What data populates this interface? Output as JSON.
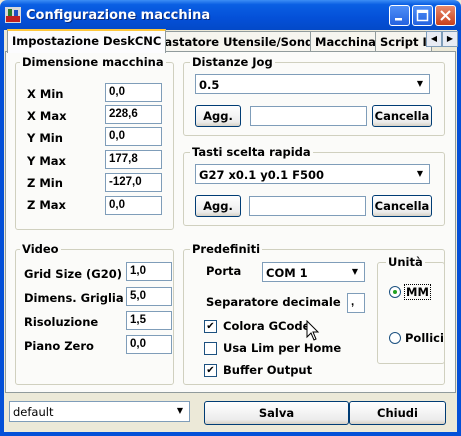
{
  "window": {
    "title": "Configurazione macchina"
  },
  "tabs": [
    "Impostazione DeskCNC",
    "Tastatore Utensile/Sonda",
    "Macchina",
    "Script I"
  ],
  "dimensione": {
    "title": "Dimensione macchina",
    "rows": [
      {
        "label": "X Min",
        "value": "0,0"
      },
      {
        "label": "X Max",
        "value": "228,6"
      },
      {
        "label": "Y Min",
        "value": "0,0"
      },
      {
        "label": "Y Max",
        "value": "177,8"
      },
      {
        "label": "Z Min",
        "value": "-127,0"
      },
      {
        "label": "Z Max",
        "value": "0,0"
      }
    ]
  },
  "jog": {
    "title": "Distanze Jog",
    "selected": "0.5",
    "add": "Agg.",
    "input": "",
    "delete": "Cancella"
  },
  "rapidi": {
    "title": "Tasti scelta rapida",
    "selected": "G27 x0.1 y0.1 F500",
    "add": "Agg.",
    "input": "",
    "delete": "Cancella"
  },
  "video": {
    "title": "Video",
    "rows": [
      {
        "label": "Grid Size (G20)",
        "value": "1,0"
      },
      {
        "label": "Dimens. Griglia",
        "value": "5,0"
      },
      {
        "label": "Risoluzione",
        "value": "1,5"
      },
      {
        "label": "Piano Zero",
        "value": "0,0"
      }
    ]
  },
  "predefiniti": {
    "title": "Predefiniti",
    "porta_label": "Porta",
    "porta_value": "COM 1",
    "separatore_label": "Separatore decimale",
    "separatore_value": ",",
    "colora": {
      "label": "Colora GCode",
      "checked": true
    },
    "usalim": {
      "label": "Usa Lim per Home",
      "checked": false
    },
    "buffer": {
      "label": "Buffer Output",
      "checked": true
    },
    "unita": {
      "title": "Unità",
      "mm": "MM",
      "pollici": "Pollici",
      "selected": "MM"
    }
  },
  "bottom": {
    "profile": "default",
    "save": "Salva",
    "close": "Chiudi"
  }
}
